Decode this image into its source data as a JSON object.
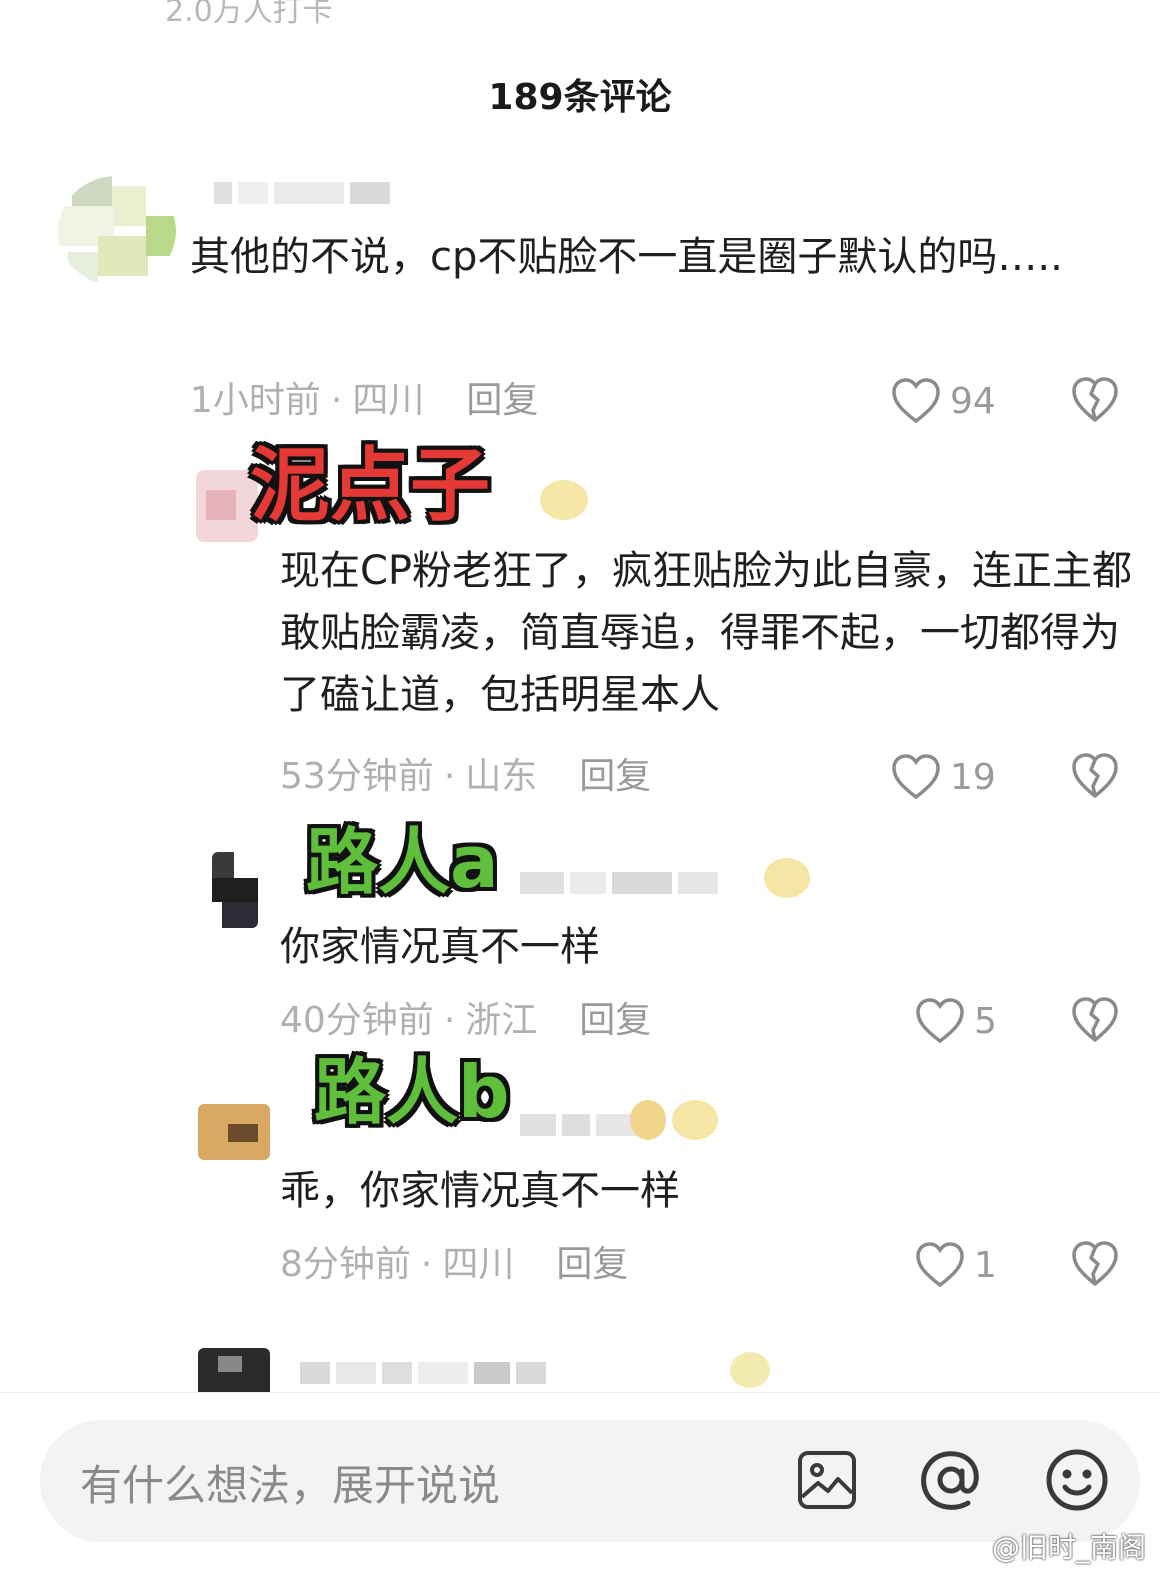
{
  "header": {
    "top_hint": "2.0万人打卡",
    "comment_count_title": "189条评论"
  },
  "comments": [
    {
      "text": "其他的不说，cp不贴脸不一直是圈子默认的吗…..",
      "time": "1小时前",
      "location": "四川",
      "reply_label": "回复",
      "likes": "94"
    },
    {
      "overlay_label": "泥点子",
      "text": "现在CP粉老狂了，疯狂贴脸为此自豪，连正主都敢贴脸霸凌，简直辱追，得罪不起，一切都得为了磕让道，包括明星本人",
      "time": "53分钟前",
      "location": "山东",
      "reply_label": "回复",
      "likes": "19"
    },
    {
      "overlay_label": "路人a",
      "text": "你家情况真不一样",
      "time": "40分钟前",
      "location": "浙江",
      "reply_label": "回复",
      "likes": "5"
    },
    {
      "overlay_label": "路人b",
      "text": "乖，你家情况真不一样",
      "time": "8分钟前",
      "location": "四川",
      "reply_label": "回复",
      "likes": "1"
    }
  ],
  "input": {
    "placeholder": "有什么想法，展开说说"
  },
  "watermark": "@旧时_南阁",
  "colors": {
    "overlay_red": "#e53935",
    "overlay_green": "#5fbf3a",
    "meta_gray": "#b0b0b0"
  },
  "icons": [
    "heart-icon",
    "broken-heart-icon",
    "image-icon",
    "at-icon",
    "emoji-icon"
  ]
}
